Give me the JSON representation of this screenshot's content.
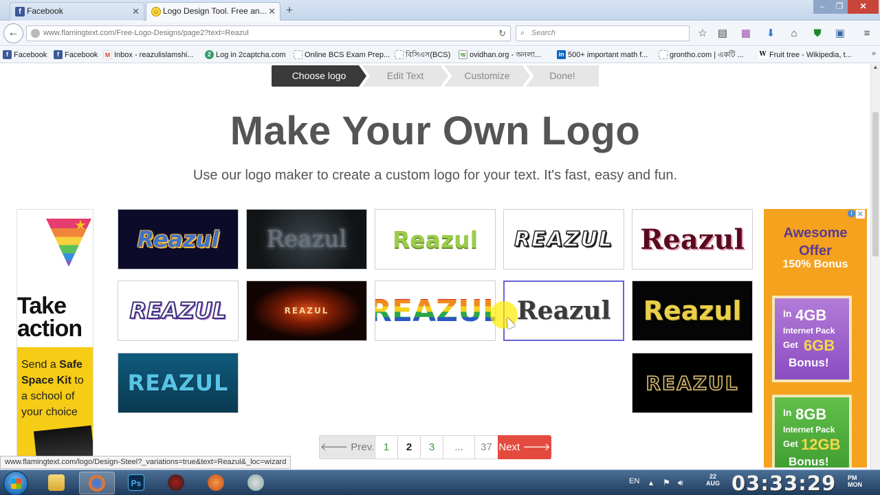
{
  "browser": {
    "tabs": [
      {
        "label": "Facebook",
        "icon": "facebook-icon"
      },
      {
        "label": "Logo Design Tool. Free an...",
        "icon": "smiley-icon"
      }
    ],
    "url": "www.flamingtext.com/Free-Logo-Designs/page2?text=Reazul",
    "search_placeholder": "Search",
    "bookmarks": [
      {
        "label": "Facebook",
        "icon": "facebook-icon"
      },
      {
        "label": "Facebook",
        "icon": "facebook-icon"
      },
      {
        "label": "Inbox - reazulislamshi...",
        "icon": "gmail-icon"
      },
      {
        "label": "Log in 2captcha.com",
        "icon": "captcha-icon"
      },
      {
        "label": "Online BCS Exam Prep...",
        "icon": "page-icon"
      },
      {
        "label": "বিসিএস(BCS)",
        "icon": "page-icon"
      },
      {
        "label": "ovidhan.org - অনলা...",
        "icon": "ovidhan-icon"
      },
      {
        "label": "500+ important math f...",
        "icon": "linkedin-icon"
      },
      {
        "label": "grontho.com | একটি ...",
        "icon": "page-icon"
      },
      {
        "label": "Fruit tree - Wikipedia, t...",
        "icon": "wikipedia-icon"
      }
    ]
  },
  "wizard": {
    "steps": [
      "Choose logo",
      "Edit Text",
      "Customize",
      "Done!"
    ],
    "active_step": "Choose logo"
  },
  "hero": {
    "title": "Make Your Own Logo",
    "subtitle": "Use our logo maker to create a custom logo for your text. It's fast, easy and fun."
  },
  "logos": [
    {
      "text": "Reazul"
    },
    {
      "text": "Reazul"
    },
    {
      "text": "Reazul"
    },
    {
      "text": "REAZUL"
    },
    {
      "text": "Reazul"
    },
    {
      "text": "REAZUL"
    },
    {
      "text": "REAZUL"
    },
    {
      "text": "REAZUL"
    },
    {
      "text": "Reazul"
    },
    {
      "text": "Reazul"
    },
    {
      "text": "REAZUL"
    },
    {
      "text": "REAZUL"
    }
  ],
  "ad_left": {
    "headline_1": "Take",
    "headline_2": "action",
    "body_1": "Send a ",
    "body_bold": "Safe Space Kit",
    "body_2": " to a school of your choice"
  },
  "ad_right": {
    "line_a": "Awesome",
    "line_b": "Offer",
    "bonus": "150% Bonus",
    "pack1": {
      "in": "In",
      "size": "4GB",
      "label": "Internet Pack",
      "get": "Get",
      "bonus_size": "6GB",
      "bonus": "Bonus!"
    },
    "pack2": {
      "in": "In",
      "size": "8GB",
      "label": "Internet Pack",
      "get": "Get",
      "bonus_size": "12GB",
      "bonus": "Bonus!"
    }
  },
  "pagination": {
    "prev": "Prev.",
    "pages": [
      "1",
      "2",
      "3",
      "...",
      "37"
    ],
    "current": "2",
    "next": "Next"
  },
  "status_url": "www.flamingtext.com/logo/Design-Steel?_variations=true&text=Reazul&_loc=wizard",
  "taskbar": {
    "language": "EN",
    "date_line1": "22",
    "date_line2": "AUG",
    "time": "03:33:29",
    "ampm_line1": "PM",
    "ampm_line2": "MON"
  }
}
